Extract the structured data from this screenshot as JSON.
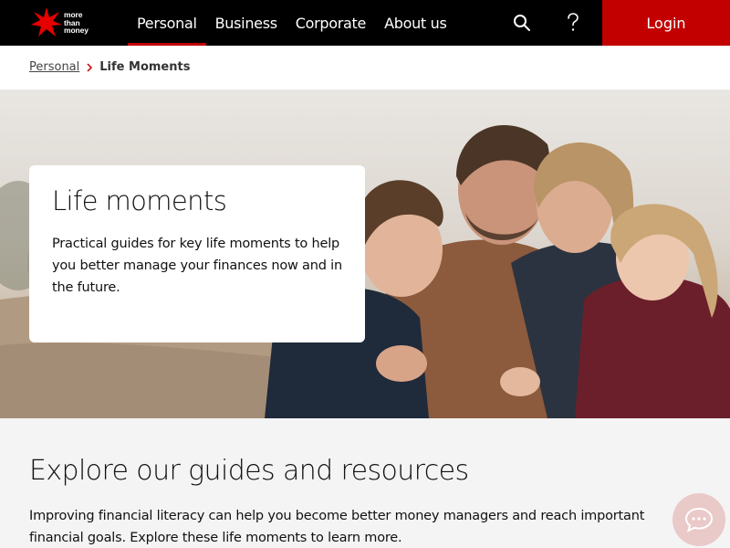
{
  "brand": {
    "logo_line1": "more",
    "logo_line2": "than",
    "logo_line3": "money",
    "accent_color": "#c20000"
  },
  "nav": {
    "items": [
      {
        "label": "Personal",
        "active": true
      },
      {
        "label": "Business"
      },
      {
        "label": "Corporate"
      },
      {
        "label": "About us"
      }
    ],
    "search_icon": "search-icon",
    "help_icon": "question-mark-icon",
    "login_label": "Login"
  },
  "breadcrumb": {
    "parent": "Personal",
    "current": "Life Moments"
  },
  "hero": {
    "title": "Life moments",
    "description": "Practical guides for key life moments to help you better manage your finances now and in the future."
  },
  "explore": {
    "title": "Explore our guides and resources",
    "text": "Improving financial literacy can help you become better money managers and reach important financial goals. Explore these life moments to learn more."
  },
  "chat": {
    "icon": "chat-bubble-icon"
  }
}
